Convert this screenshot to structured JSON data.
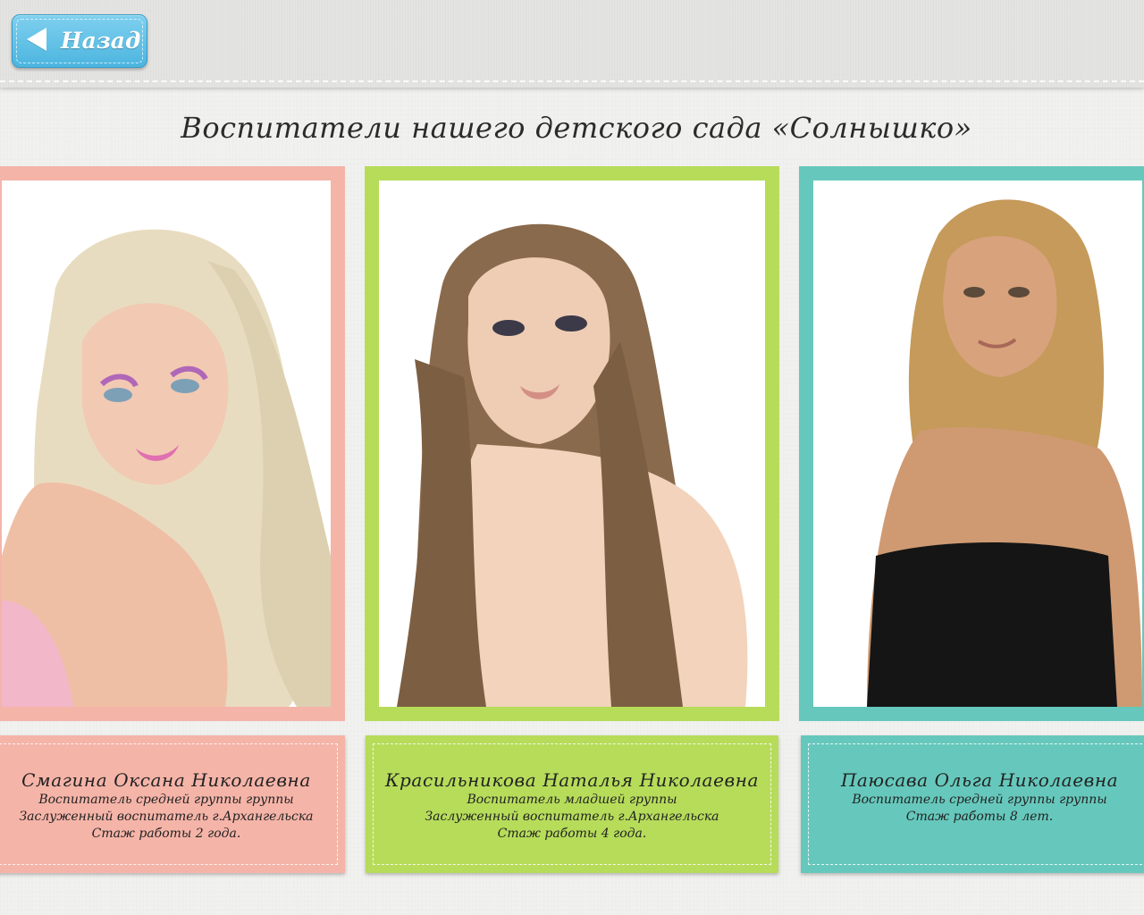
{
  "header": {
    "back_label": "Назад"
  },
  "page": {
    "title": "Воспитатели нашего детского сада «Солнышко»"
  },
  "teachers": [
    {
      "name": "Смагина Оксана Николаевна",
      "lines": [
        "Воспитатель средней группы группы",
        "Заслуженный воспитатель г.Архангельска",
        "Стаж работы 2 года."
      ],
      "frame_color": "#f5b4a8"
    },
    {
      "name": "Красильникова Наталья Николаевна",
      "lines": [
        "Воспитатель младшей группы",
        "Заслуженный воспитатель г.Архангельска",
        "Стаж работы 4 года."
      ],
      "frame_color": "#b6dc5a"
    },
    {
      "name": "Паюсава Ольга Николаевна",
      "lines": [
        "Воспитатель средней группы группы",
        "Стаж работы 8 лет."
      ],
      "frame_color": "#66c8bc"
    }
  ]
}
